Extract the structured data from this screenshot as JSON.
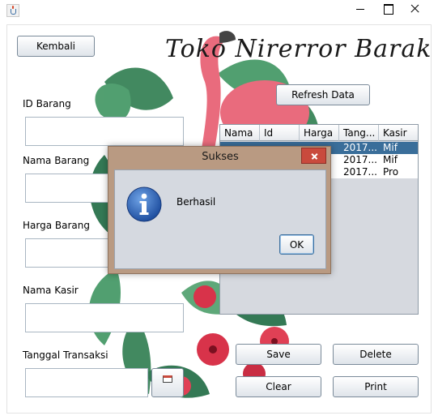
{
  "window": {
    "title": "",
    "icon": "java-icon"
  },
  "header": {
    "store_name": "Toko Nirerror Barakallah",
    "back_label": "Kembali",
    "refresh_label": "Refresh Data"
  },
  "form": {
    "id_barang_label": "ID Barang",
    "id_barang_value": "",
    "nama_barang_label": "Nama Barang",
    "nama_barang_value": "",
    "harga_barang_label": "Harga Barang",
    "harga_barang_value": "",
    "nama_kasir_label": "Nama Kasir",
    "nama_kasir_value": "",
    "tanggal_label": "Tanggal Transaksi",
    "tanggal_value": ""
  },
  "table": {
    "columns": [
      "Nama",
      "Id",
      "Harga",
      "Tang...",
      "Kasir"
    ],
    "rows": [
      {
        "nama": "",
        "id": "",
        "harga": "",
        "tanggal": "2017...",
        "kasir": "Mif"
      },
      {
        "nama": "",
        "id": "",
        "harga": "",
        "tanggal": "2017...",
        "kasir": "Mif"
      },
      {
        "nama": "",
        "id": "",
        "harga": "",
        "tanggal": "2017...",
        "kasir": "Pro"
      }
    ],
    "selected_row": 0
  },
  "actions": {
    "save_label": "Save",
    "delete_label": "Delete",
    "clear_label": "Clear",
    "print_label": "Print"
  },
  "dialog": {
    "title": "Sukses",
    "message": "Berhasil",
    "ok_label": "OK",
    "icon": "info-icon"
  },
  "colors": {
    "selection": "#3a6e9a",
    "dialog_border": "#b99a82",
    "close_button": "#c94a3d",
    "flamingo": "#e96b7d",
    "leaf": "#2e7d4f"
  }
}
